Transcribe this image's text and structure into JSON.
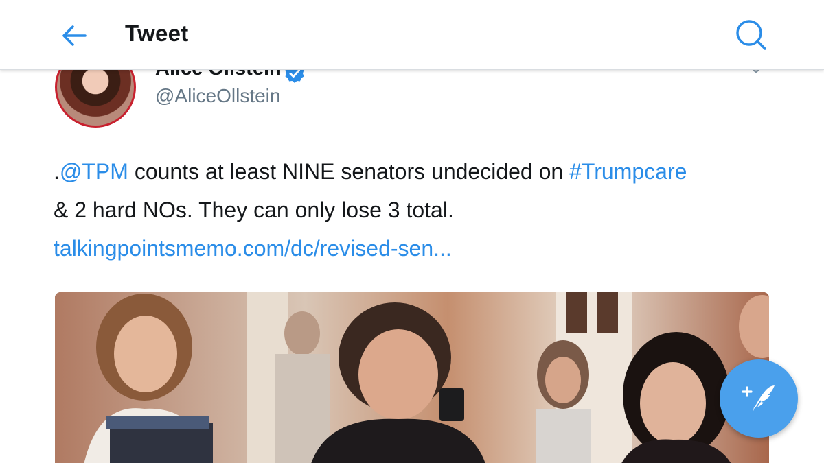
{
  "nav": {
    "title": "Tweet",
    "back_icon": "arrow-left-icon",
    "search_icon": "search-icon"
  },
  "tweet": {
    "author": {
      "display_name": "Alice Ollstein",
      "handle": "@AliceOllstein",
      "verified": true
    },
    "text": {
      "prefix": ".",
      "mention": "@TPM",
      "middle": " counts at least NINE senators undecided on ",
      "hashtag": "#Trumpcare",
      "line2": "& 2 hard NOs. They can only lose 3 total.",
      "url": "talkingpointsmemo.com/dc/revised-sen..."
    }
  },
  "compose": {
    "icon": "compose-tweet-icon"
  },
  "colors": {
    "accent": "#2b8de8",
    "fab": "#4aa0ec",
    "text": "#14171a",
    "secondary": "#657786"
  }
}
